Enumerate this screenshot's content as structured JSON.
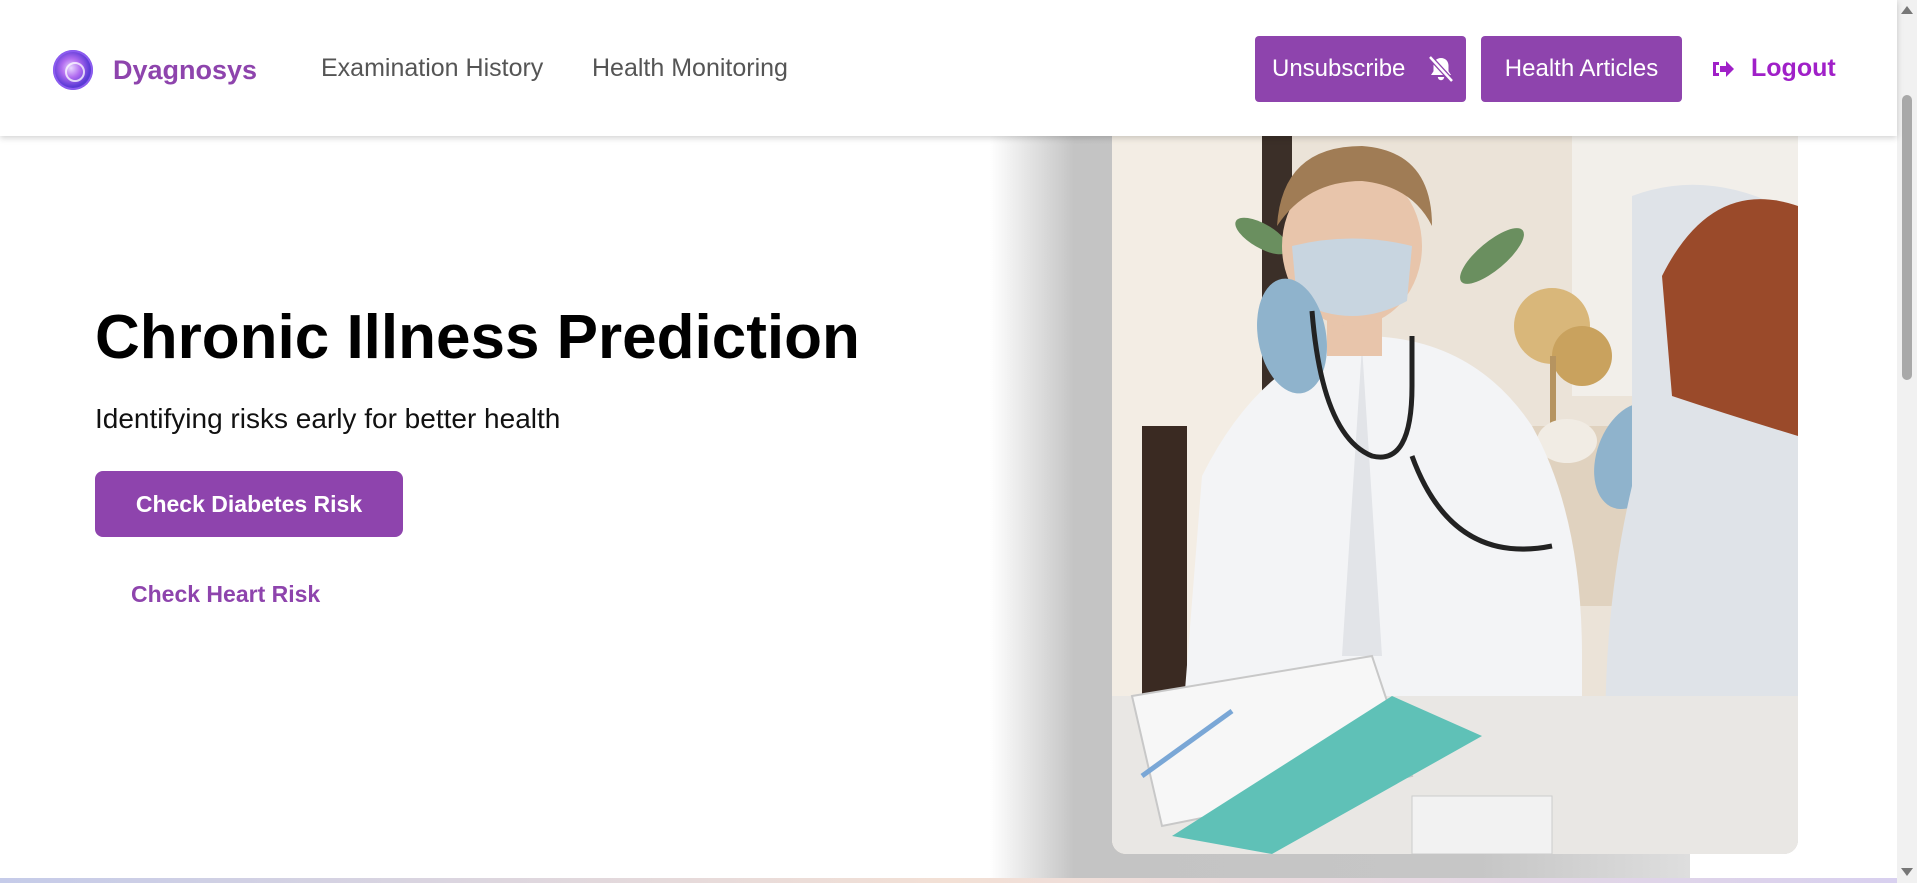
{
  "header": {
    "brand_name": "Dyagnosys",
    "nav": {
      "examination_history": "Examination History",
      "health_monitoring": "Health Monitoring"
    },
    "unsubscribe_label": "Unsubscribe",
    "unsubscribe_icon": "bell-slash-icon",
    "health_articles_label": "Health Articles",
    "logout_label": "Logout",
    "logout_icon": "sign-out-icon"
  },
  "hero": {
    "title": "Chronic Illness Prediction",
    "subtitle": "Identifying risks early for better health",
    "primary_button": "Check Diabetes Risk",
    "secondary_link": "Check Heart Risk"
  },
  "colors": {
    "brand_purple": "#8e44ad",
    "logout_purple": "#a020c8"
  }
}
